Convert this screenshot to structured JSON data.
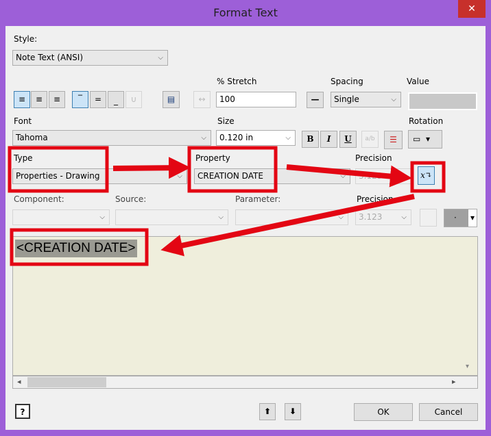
{
  "window": {
    "title": "Format Text",
    "close": "✕"
  },
  "style": {
    "label": "Style:",
    "value": "Note Text (ANSI)"
  },
  "stretch": {
    "label": "% Stretch",
    "value": "100"
  },
  "spacing": {
    "label": "Spacing",
    "value": "Single"
  },
  "value_field": {
    "label": "Value"
  },
  "font": {
    "label": "Font",
    "value": "Tahoma"
  },
  "size": {
    "label": "Size",
    "value": "0.120 in"
  },
  "format": {
    "bold": "B",
    "italic": "I",
    "underline": "U",
    "stack": "a/b"
  },
  "rotation": {
    "label": "Rotation"
  },
  "type": {
    "label": "Type",
    "value": "Properties - Drawing"
  },
  "property": {
    "label": "Property",
    "value": "CREATION DATE"
  },
  "precision1": {
    "label": "Precision",
    "value": "3.123"
  },
  "component": {
    "label": "Component:"
  },
  "source": {
    "label": "Source:"
  },
  "parameter": {
    "label": "Parameter:"
  },
  "precision2": {
    "label": "Precision",
    "value": "3.123"
  },
  "editor": {
    "text": "<CREATION DATE>"
  },
  "footer": {
    "help": "?",
    "ok": "OK",
    "cancel": "Cancel"
  },
  "colors": {
    "accent": "#9d5fd8",
    "annotation": "#e30613",
    "editor_bg": "#efeedc"
  }
}
